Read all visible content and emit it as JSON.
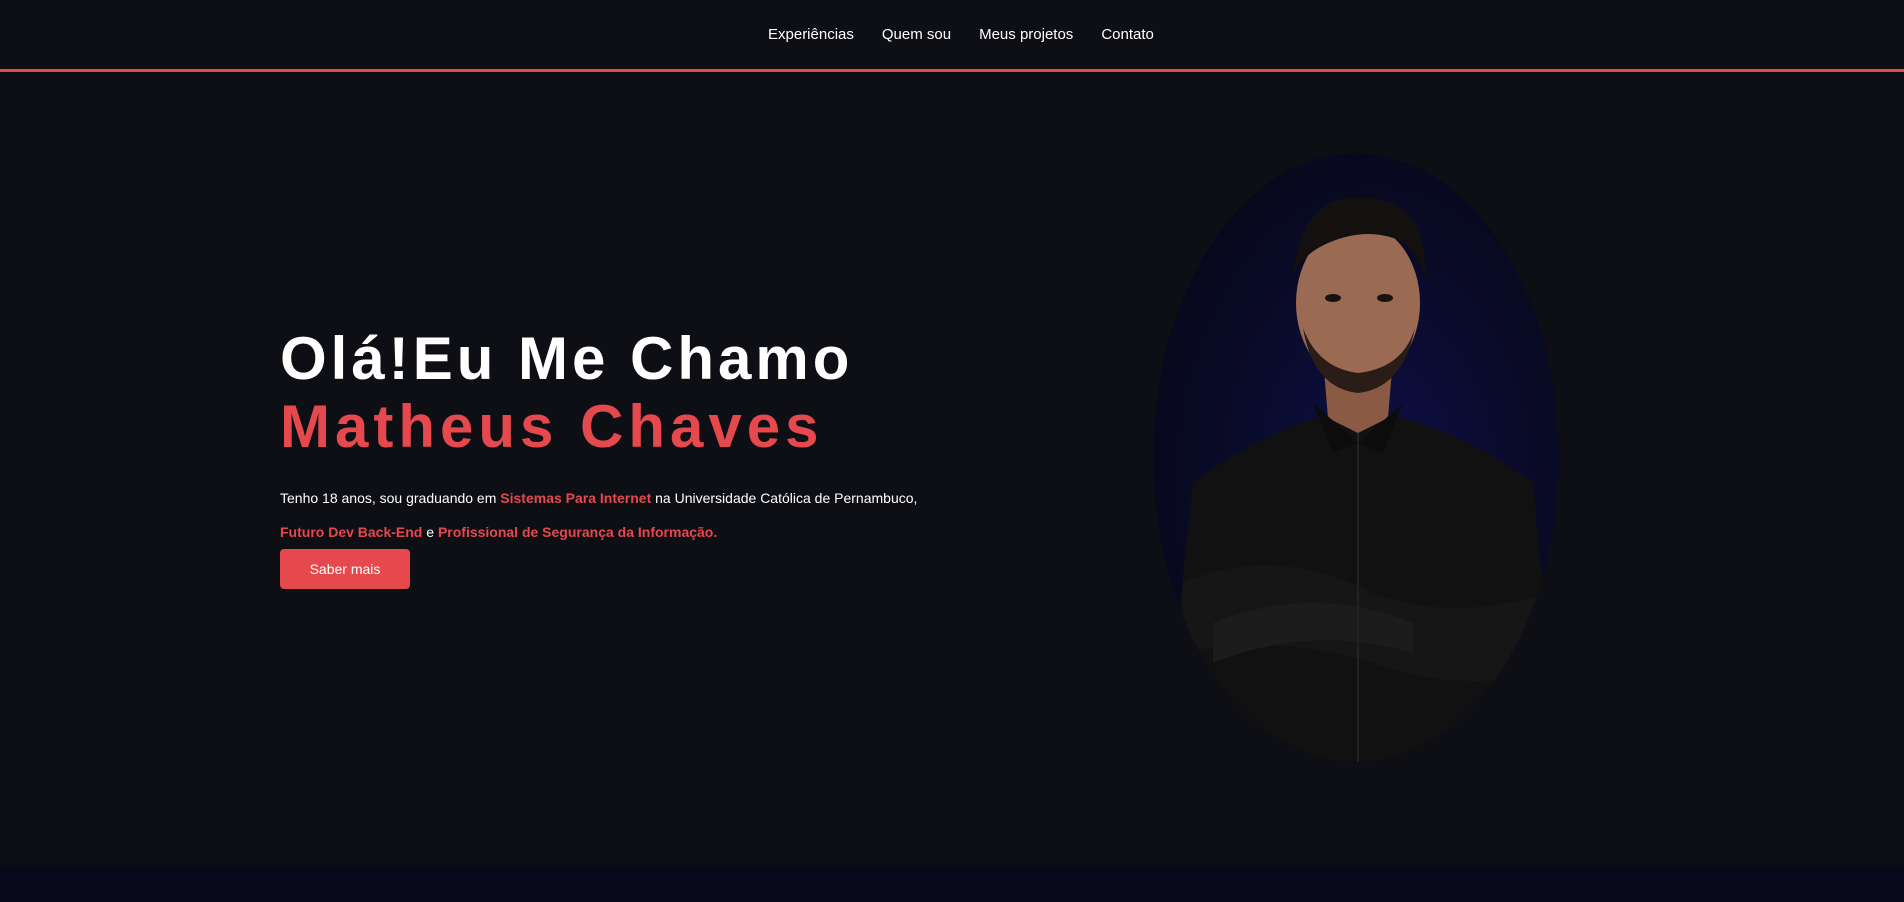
{
  "nav": {
    "items": [
      {
        "label": "Experiências"
      },
      {
        "label": "Quem sou"
      },
      {
        "label": "Meus projetos"
      },
      {
        "label": "Contato"
      }
    ]
  },
  "hero": {
    "greeting": "Olá!Eu Me Chamo",
    "name": "Matheus Chaves",
    "desc_line1": {
      "pre": "Tenho 18 anos, sou graduando em ",
      "highlight": "Sistemas Para Internet",
      "post": " na Universidade Católica de Pernambuco,"
    },
    "desc_line2": {
      "highlight1": "Futuro Dev Back-End",
      "conj": " e ",
      "highlight2": "Profissional de Segurança da Informação."
    },
    "cta_label": "Saber mais"
  },
  "colors": {
    "accent": "#e5484d",
    "background": "#0e0f14",
    "text": "#ffffff"
  }
}
